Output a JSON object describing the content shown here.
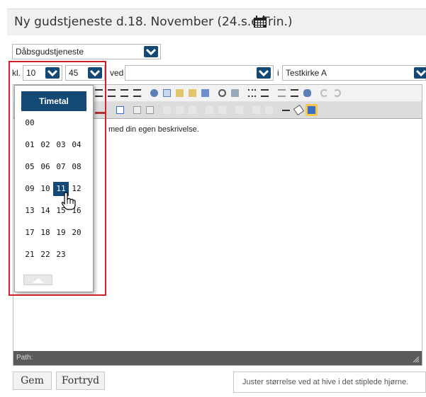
{
  "header": {
    "title": "Ny gudstjeneste d.18. November (24.s.e.Trin.)",
    "calendar_icon": "calendar-icon"
  },
  "service_type": {
    "value": "Dåbsgudstjeneste"
  },
  "time_row": {
    "kl_label": "kl.",
    "hour_value": "10",
    "minute_value": "45",
    "ved_label": "ved",
    "ved_value": "",
    "i_label": "i",
    "church_value": "Testkirke A"
  },
  "editor": {
    "content_fragment": "med din egen beskrivelse.",
    "path_label": "Path:"
  },
  "hour_picker": {
    "title": "Timetal",
    "rows": [
      [
        "00"
      ],
      [
        "01",
        "02",
        "03",
        "04"
      ],
      [
        "05",
        "06",
        "07",
        "08"
      ],
      [
        "09",
        "10",
        "11",
        "12"
      ],
      [
        "13",
        "14",
        "15",
        "16"
      ],
      [
        "17",
        "18",
        "19",
        "20"
      ],
      [
        "21",
        "22",
        "23"
      ]
    ],
    "selected": "11",
    "scroll_up_icon": "chevron-up-icon"
  },
  "footer": {
    "save_label": "Gem",
    "cancel_label": "Fortryd",
    "hint": "Juster størrelse ved at hive i det stiplede hjørne."
  },
  "colors": {
    "accent": "#134974",
    "highlight_border": "#d11f2c",
    "path_bar": "#5a5a5a"
  }
}
